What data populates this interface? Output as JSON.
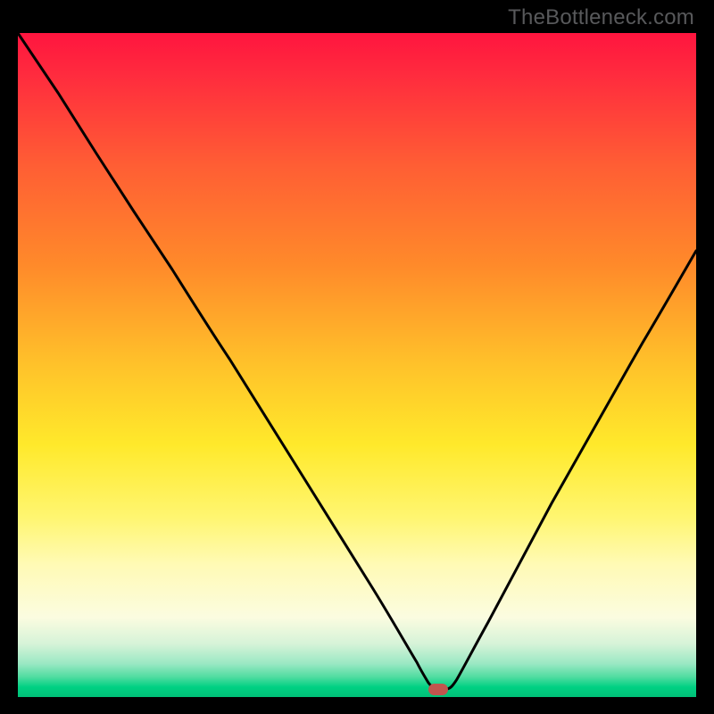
{
  "watermark": "TheBottleneck.com",
  "chart_data": {
    "type": "line",
    "title": "",
    "xlabel": "",
    "ylabel": "",
    "x": [
      0,
      5,
      10,
      15,
      20,
      25,
      30,
      35,
      40,
      45,
      50,
      55,
      58,
      60,
      62,
      64,
      70,
      80,
      90,
      100
    ],
    "values": [
      100,
      91,
      82,
      73,
      64,
      55,
      47,
      38,
      29,
      20,
      12,
      5,
      1,
      0,
      0,
      2,
      12,
      30,
      48,
      65
    ],
    "xlim": [
      0,
      100
    ],
    "ylim": [
      0,
      100
    ],
    "minimum_marker": {
      "x": 61,
      "y": 0
    },
    "gradient_bands": [
      {
        "color_top": "#ff153f",
        "color_bottom": "#ff153f",
        "from": 0,
        "to": 6
      },
      {
        "color_top": "#ff153f",
        "color_bottom": "#ff8a2a",
        "from": 6,
        "to": 35
      },
      {
        "color_top": "#ff8a2a",
        "color_bottom": "#ffe92b",
        "from": 35,
        "to": 62
      },
      {
        "color_top": "#ffe92b",
        "color_bottom": "#fff9a0",
        "from": 62,
        "to": 78
      },
      {
        "color_top": "#fff9a0",
        "color_bottom": "#f7fae0",
        "from": 78,
        "to": 90
      },
      {
        "color_top": "#f7fae0",
        "color_bottom": "#8fe9c0",
        "from": 90,
        "to": 96
      },
      {
        "color_top": "#8fe9c0",
        "color_bottom": "#00d684",
        "from": 96,
        "to": 99
      },
      {
        "color_top": "#00d684",
        "color_bottom": "#00c078",
        "from": 99,
        "to": 100
      }
    ]
  }
}
